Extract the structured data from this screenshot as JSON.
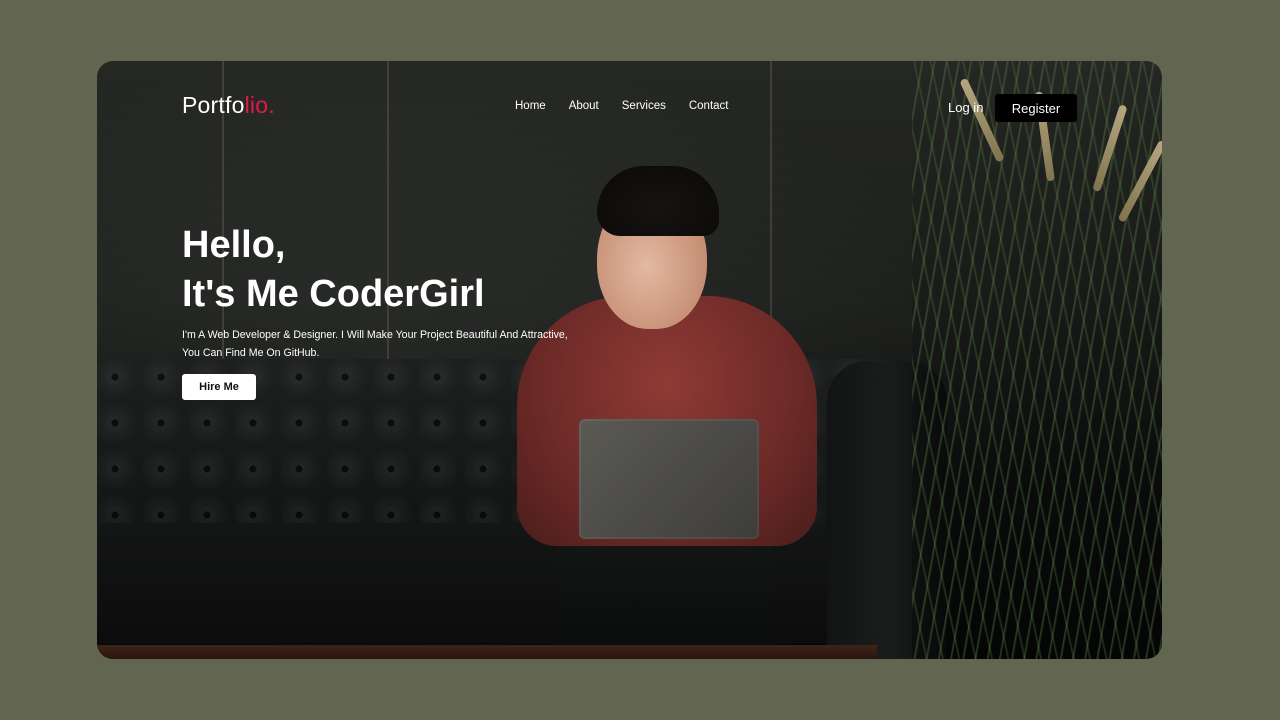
{
  "brand": {
    "logo_main": "Portfo",
    "logo_accent": "lio.",
    "accent_color": "#e1194a"
  },
  "nav": {
    "items": [
      "Home",
      "About",
      "Services",
      "Contact"
    ]
  },
  "auth": {
    "login_label": "Log in",
    "register_label": "Register"
  },
  "hero": {
    "line1": "Hello,",
    "line2": "It's Me CoderGirl",
    "description_line1": "I'm A Web Developer & Designer. I Will Make Your Project Beautiful And Attractive,",
    "description_line2": "You Can Find Me On GitHub.",
    "cta_label": "Hire Me"
  },
  "colors": {
    "page_bg": "#626650",
    "register_bg": "#000000",
    "cta_bg": "#ffffff"
  }
}
